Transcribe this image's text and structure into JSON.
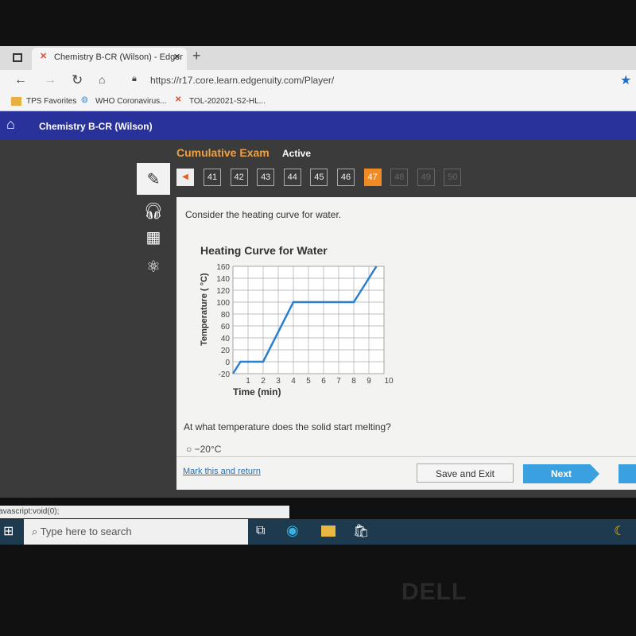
{
  "browser": {
    "tab_title": "Chemistry B-CR (Wilson) - Edger",
    "url": "https://r17.core.learn.edgenuity.com/Player/",
    "bookmarks": [
      "TPS Favorites",
      "WHO Coronavirus...",
      "TOL-202021-S2-HL..."
    ]
  },
  "header": {
    "course": "Chemistry B-CR (Wilson)"
  },
  "exam": {
    "title": "Cumulative Exam",
    "status": "Active",
    "pages": [
      "41",
      "42",
      "43",
      "44",
      "45",
      "46",
      "47",
      "48",
      "49",
      "50"
    ],
    "current": "47"
  },
  "question": {
    "prompt": "Consider the heating curve for water.",
    "question": "At what temperature does the solid start melting?",
    "options": [
      "−20°C"
    ]
  },
  "actions": {
    "mark": "Mark this and return",
    "save": "Save and Exit",
    "next": "Next"
  },
  "status_bar": "javascript:void(0);",
  "taskbar": {
    "search_placeholder": "Type here to search"
  },
  "brand": "DELL",
  "colors": {
    "header": "#28329a",
    "current_page": "#f08a24",
    "line": "#2a7fd0",
    "next": "#3aa0e0"
  },
  "chart_data": {
    "type": "line",
    "title": "Heating Curve for Water",
    "xlabel": "Time (min)",
    "ylabel": "Temperature ( °C)",
    "xlim": [
      0,
      10
    ],
    "ylim": [
      -20,
      160
    ],
    "xticks": [
      1,
      2,
      3,
      4,
      5,
      6,
      7,
      8,
      9,
      10
    ],
    "yticks": [
      160,
      140,
      120,
      100,
      80,
      60,
      40,
      20,
      0,
      -20
    ],
    "grid": true,
    "x": [
      0,
      0.5,
      2,
      4,
      8,
      9.5
    ],
    "y": [
      -20,
      0,
      0,
      100,
      100,
      160
    ]
  }
}
